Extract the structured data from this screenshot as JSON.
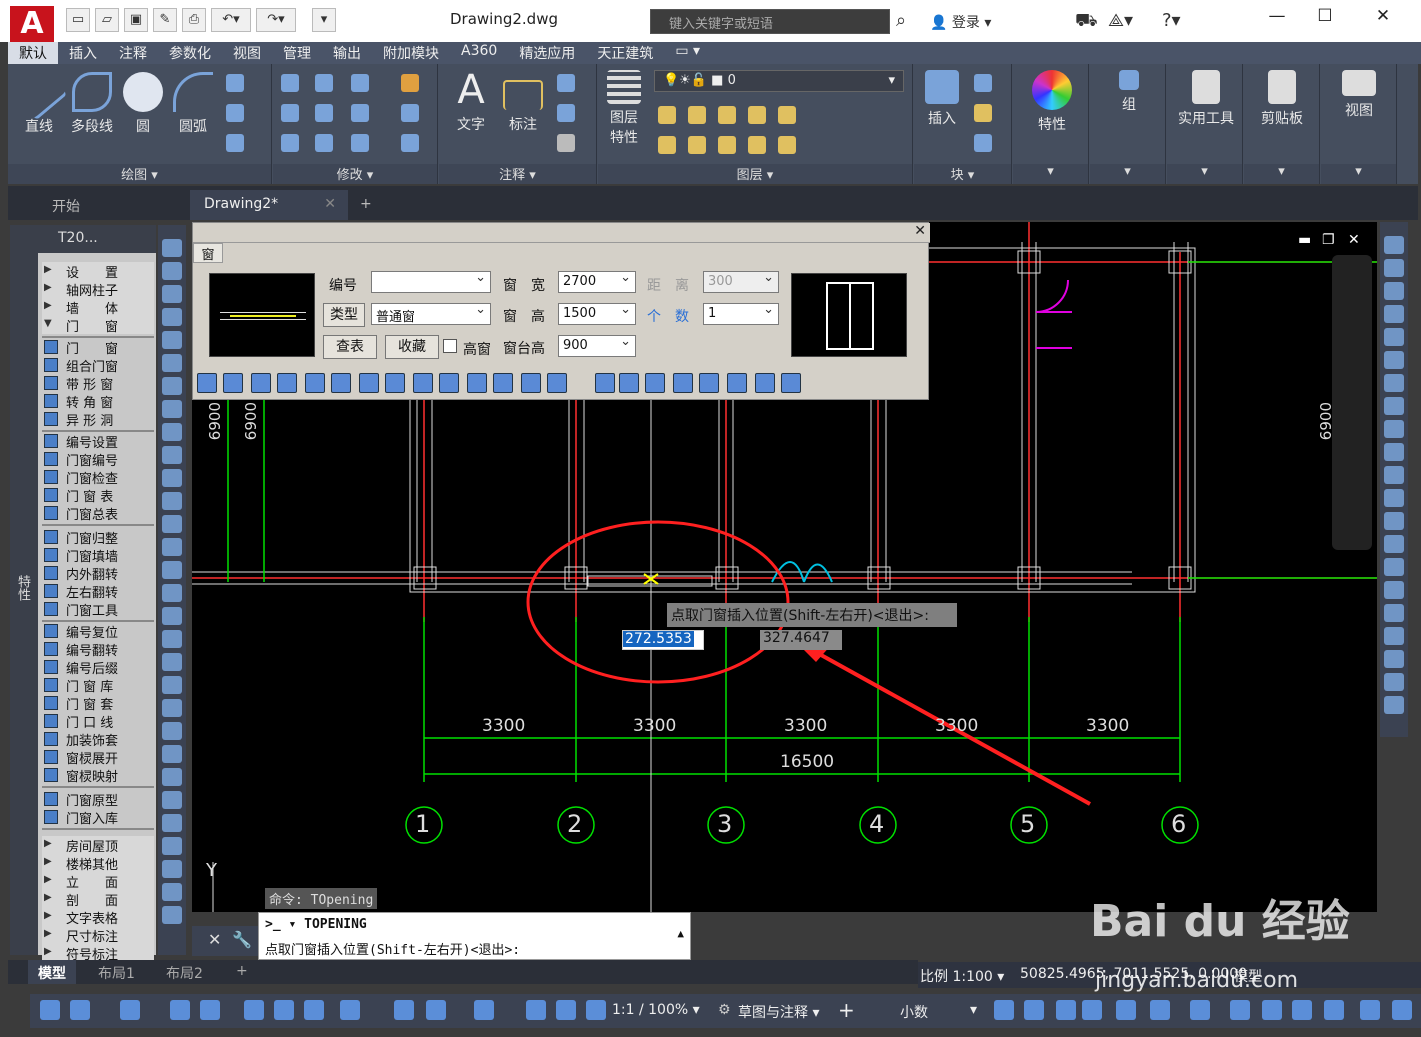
{
  "app": {
    "document_title": "Drawing2.dwg",
    "search_placeholder": "键入关键字或短语",
    "login": "登录",
    "logo": "A"
  },
  "menu": [
    "默认",
    "插入",
    "注释",
    "参数化",
    "视图",
    "管理",
    "输出",
    "附加模块",
    "A360",
    "精选应用",
    "天正建筑"
  ],
  "ribbon": {
    "draw": {
      "items": [
        "直线",
        "多段线",
        "圆",
        "圆弧"
      ],
      "label": "绘图 ▾"
    },
    "modify": {
      "label": "修改 ▾"
    },
    "annotate": {
      "items": [
        "文字",
        "标注"
      ],
      "label": "注释 ▾"
    },
    "layers": {
      "items": [
        "图层\n特性"
      ],
      "label": "图层 ▾",
      "layer_value": "0"
    },
    "block": {
      "items": [
        "插入"
      ],
      "label": "块 ▾"
    },
    "props": {
      "items": [
        "特性"
      ]
    },
    "group": {
      "items": [
        "组"
      ]
    },
    "utils": {
      "items": [
        "实用工具"
      ]
    },
    "clip": {
      "items": [
        "剪贴板"
      ]
    },
    "view": {
      "items": [
        "视图"
      ]
    }
  },
  "doc_tabs": [
    "开始",
    "Drawing2*",
    "+"
  ],
  "palette": {
    "title": "T20...",
    "side_label": "特性",
    "groups": [
      [
        "设　　置",
        "轴网柱子",
        "墙　　体",
        "门　　窗"
      ],
      [
        "门　　窗",
        "组合门窗",
        "带 形 窗",
        "转 角 窗",
        "异 形 洞"
      ],
      [
        "编号设置",
        "门窗编号",
        "门窗检查",
        "门 窗 表",
        "门窗总表"
      ],
      [
        "门窗归整",
        "门窗填墙",
        "内外翻转",
        "左右翻转",
        "门窗工具"
      ],
      [
        "编号复位",
        "编号翻转",
        "编号后缀",
        "门 窗 库",
        "门 窗 套",
        "门 口 线",
        "加装饰套",
        "窗棂展开",
        "窗棂映射"
      ],
      [
        "门窗原型",
        "门窗入库"
      ],
      [
        "房间屋顶",
        "楼梯其他",
        "立　　面",
        "剖　　面",
        "文字表格",
        "尺寸标注",
        "符号标注"
      ]
    ]
  },
  "window_dialog": {
    "title": "窗",
    "number_label": "编号",
    "number_value": "",
    "type_button": "类型",
    "type_value": "普通窗",
    "search_button": "查表",
    "fav_button": "收藏",
    "high_window_label": "高窗",
    "width_label": "窗　宽",
    "width_value": "2700",
    "height_label": "窗　高",
    "height_value": "1500",
    "sill_label": "窗台高",
    "sill_value": "900",
    "dist_label": "距　离",
    "dist_value": "300",
    "count_label": "个　数",
    "count_value": "1"
  },
  "canvas": {
    "dims": [
      "3300",
      "3300",
      "3300",
      "3300",
      "3300"
    ],
    "total": "16500",
    "axes": [
      "1",
      "2",
      "3",
      "4",
      "5",
      "6"
    ],
    "side_dim": "6900",
    "y_label": "Y",
    "window_controls": [
      "▬",
      "❐",
      "✕"
    ]
  },
  "prompt": {
    "tooltip": "点取门窗插入位置(Shift-左右开)<退出>:",
    "input1": "272.5353",
    "input2": "327.4647"
  },
  "command": {
    "history": "命令: TOpening",
    "current": "TOPENING",
    "prompt": "点取门窗插入位置(Shift-左右开)<退出>:"
  },
  "layout_tabs": [
    "模型",
    "布局1",
    "布局2",
    "+"
  ],
  "status": {
    "scale": "比例 1:100 ▾",
    "coords": "50825.4965, 7011.5525, 0.0000",
    "model": "模型",
    "zoom": "1:1 / 100% ▾",
    "workspace": "草图与注释 ▾",
    "unit": "小数"
  },
  "watermark": {
    "text": "Bai du 经验",
    "url": "jingyan.baidu.com"
  }
}
